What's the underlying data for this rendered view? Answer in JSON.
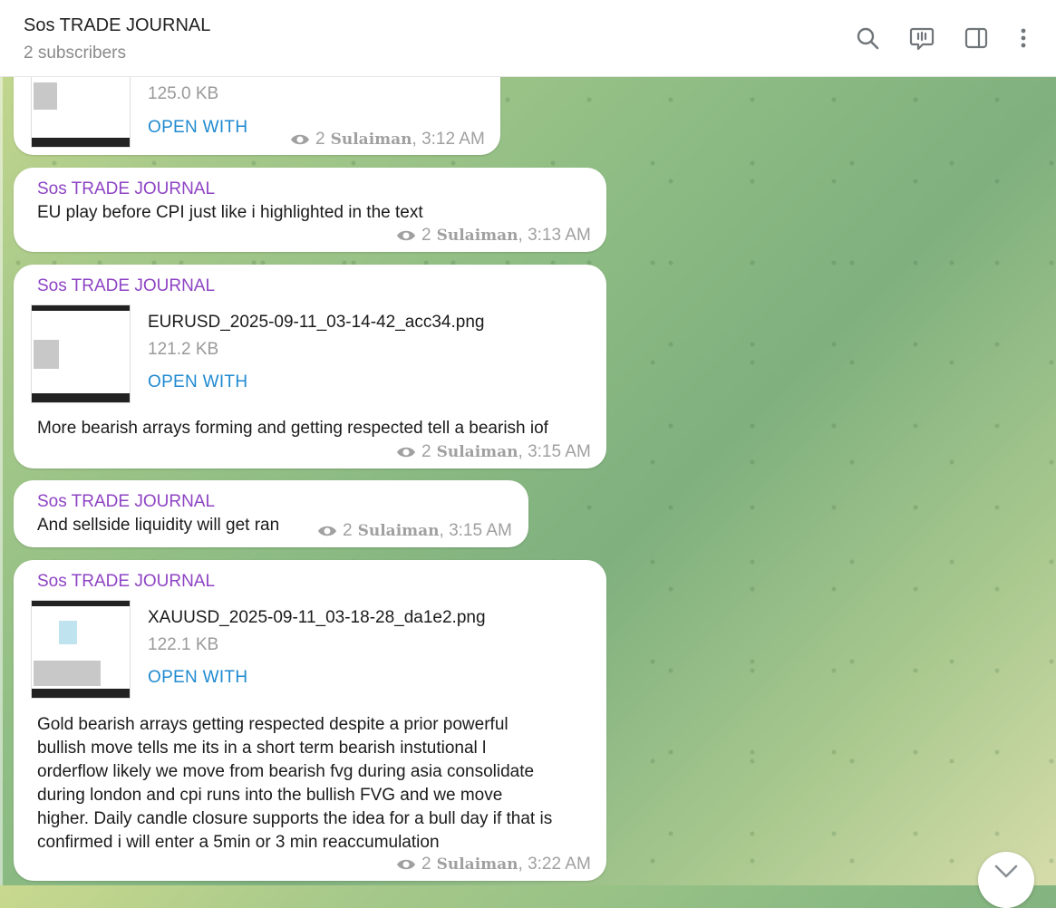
{
  "header": {
    "title": "Sos TRADE JOURNAL",
    "subtitle": "2 subscribers",
    "icons": [
      "search-icon",
      "voice-chat-icon",
      "sidebar-toggle-icon",
      "more-vertical-icon"
    ]
  },
  "messages": [
    {
      "file_size": "125.0 KB",
      "open_with": "OPEN WITH",
      "views": "2",
      "author": "Sulaiman",
      "time": ", 3:12 AM"
    },
    {
      "sender": "Sos TRADE JOURNAL",
      "text": "EU play before CPI just like i highlighted in the text",
      "views": "2",
      "author": "Sulaiman",
      "time": ", 3:13 AM"
    },
    {
      "sender": "Sos TRADE JOURNAL",
      "file_name": "EURUSD_2025-09-11_03-14-42_acc34.png",
      "file_size": "121.2 KB",
      "open_with": "OPEN WITH",
      "text": "More bearish arrays forming and getting respected tell a bearish iof",
      "views": "2",
      "author": "Sulaiman",
      "time": ", 3:15 AM"
    },
    {
      "sender": "Sos TRADE JOURNAL",
      "text": "And sellside liquidity will get ran",
      "views": "2",
      "author": "Sulaiman",
      "time": ", 3:15 AM"
    },
    {
      "sender": "Sos TRADE JOURNAL",
      "file_name": "XAUUSD_2025-09-11_03-18-28_da1e2.png",
      "file_size": "122.1 KB",
      "open_with": "OPEN WITH",
      "text_lines": [
        "Gold bearish arrays getting respected despite a prior powerful",
        "bullish move tells me its in a short term bearish instutional l",
        "orderflow likely we move from bearish fvg during asia consolidate",
        "during london and cpi runs into the bullish FVG and we move",
        "higher. Daily candle closure supports the idea for a bull day if that is",
        "confirmed i will enter a 5min or 3 min reaccumulation"
      ],
      "views": "2",
      "author": "Sulaiman",
      "time": ", 3:22 AM"
    }
  ],
  "colors": {
    "sender": "#8e44c4",
    "link": "#1f8ad0",
    "meta": "#a0a0a0"
  }
}
